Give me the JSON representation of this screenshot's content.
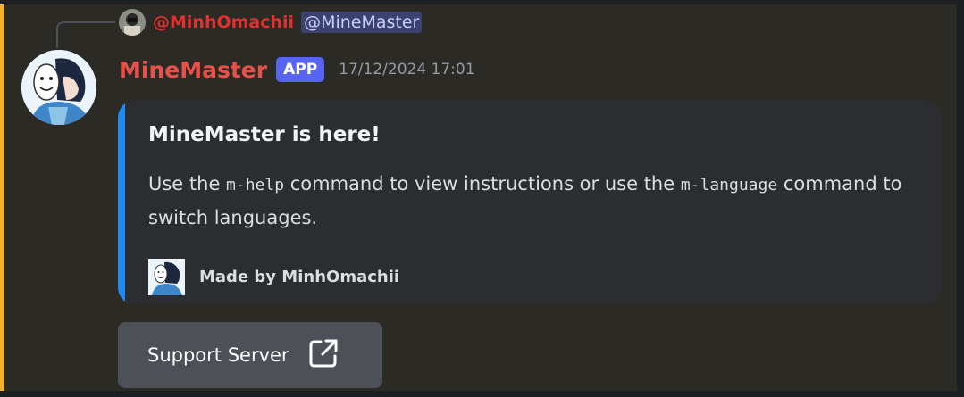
{
  "reply": {
    "author": "@MinhOmachii",
    "mention": "@MineMaster"
  },
  "message": {
    "username": "MineMaster",
    "badge": "APP",
    "timestamp": "17/12/2024 17:01"
  },
  "embed": {
    "title": "MineMaster is here!",
    "desc_part1": "Use the ",
    "code1": "m-help",
    "desc_part2": " command to view instructions or use the ",
    "code2": "m-language",
    "desc_part3": " command to switch languages.",
    "footer_text": "Made by MinhOmachii",
    "accent_color": "#1f8bf0"
  },
  "button": {
    "label": "Support Server",
    "icon": "external-link-icon"
  },
  "colors": {
    "username": "#e8514a",
    "reply_author": "#e0312e",
    "app_badge": "#5865f2",
    "mention_highlight_bar": "#f0b232"
  }
}
